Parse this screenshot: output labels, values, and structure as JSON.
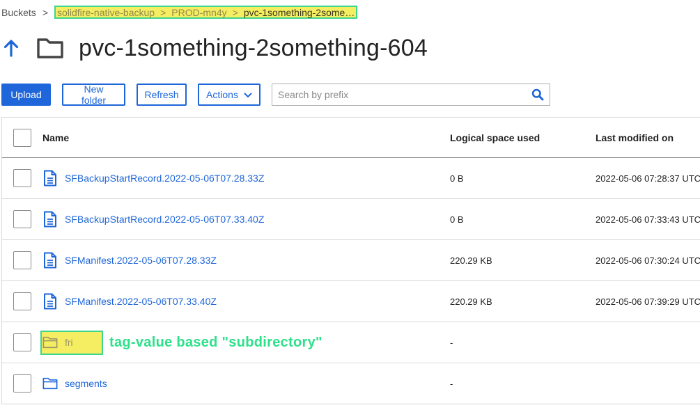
{
  "breadcrumb": {
    "root": "Buckets",
    "sep": ">",
    "bucket": "solidfire-native-backup",
    "folder": "PROD-mn4y",
    "current": "pvc-1something-2some…"
  },
  "header": {
    "title": "pvc-1something-2something-604",
    "up_icon": "arrow-up-icon",
    "folder_icon": "folder-icon"
  },
  "toolbar": {
    "upload_label": "Upload",
    "new_folder_label": "New folder",
    "refresh_label": "Refresh",
    "actions_label": "Actions",
    "search_placeholder": "Search by prefix",
    "search_value": ""
  },
  "table": {
    "columns": {
      "name": "Name",
      "size": "Logical space used",
      "modified": "Last modified on"
    },
    "rows": [
      {
        "type": "file",
        "name": "SFBackupStartRecord.2022-05-06T07.28.33Z",
        "size": "0 B",
        "modified": "2022-05-06 07:28:37 UTC"
      },
      {
        "type": "file",
        "name": "SFBackupStartRecord.2022-05-06T07.33.40Z",
        "size": "0 B",
        "modified": "2022-05-06 07:33:43 UTC"
      },
      {
        "type": "file",
        "name": "SFManifest.2022-05-06T07.28.33Z",
        "size": "220.29 KB",
        "modified": "2022-05-06 07:30:24 UTC"
      },
      {
        "type": "file",
        "name": "SFManifest.2022-05-06T07.33.40Z",
        "size": "220.29 KB",
        "modified": "2022-05-06 07:39:29 UTC"
      },
      {
        "type": "folder",
        "name": "fri",
        "size": "-",
        "modified": ""
      },
      {
        "type": "folder",
        "name": "segments",
        "size": "-",
        "modified": ""
      }
    ]
  },
  "annotation": {
    "text": "tag-value based \"subdirectory\""
  },
  "colors": {
    "accent": "#1e66d9",
    "highlight_fill": "#f5ee62",
    "highlight_border": "#3dd68c",
    "annotation": "#2ee08a"
  }
}
